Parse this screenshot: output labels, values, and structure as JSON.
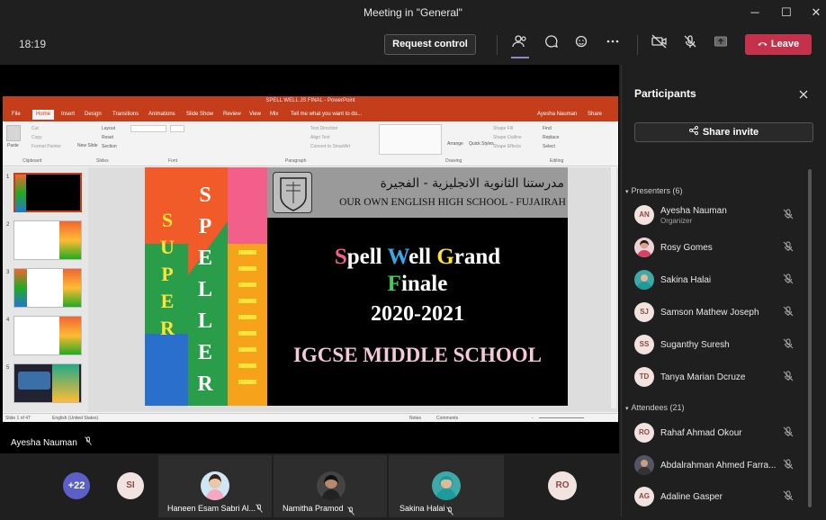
{
  "window": {
    "title": "Meeting in \"General\"",
    "minimize": "─",
    "maximize": "☐",
    "close": "✕"
  },
  "toolbar": {
    "clock": "18:19",
    "request_control": "Request control",
    "leave": "Leave"
  },
  "ppt": {
    "title": "SPELL WELL JS FINAL - PowerPoint",
    "user": "Ayesha Nauman",
    "share": "Share",
    "tell_me": "Tell me what you want to do...",
    "tabs": [
      "File",
      "Home",
      "Insert",
      "Design",
      "Transitions",
      "Animations",
      "Slide Show",
      "Review",
      "View",
      "Mix"
    ],
    "groups": [
      "Clipboard",
      "Slides",
      "Font",
      "Paragraph",
      "Drawing",
      "Editing"
    ],
    "ribbon": {
      "paste": "Paste",
      "cut": "Cut",
      "copy": "Copy",
      "format_painter": "Format Painter",
      "new_slide": "New Slide",
      "layout": "Layout",
      "reset": "Reset",
      "section": "Section",
      "text_direction": "Text Direction",
      "align_text": "Align Text",
      "smartart": "Convert to SmartArt",
      "arrange": "Arrange",
      "quick_styles": "Quick Styles",
      "shape_fill": "Shape Fill",
      "shape_outline": "Shape Outline",
      "shape_effects": "Shape Effects",
      "find": "Find",
      "replace": "Replace",
      "select": "Select"
    },
    "thumb_numbers": [
      "1",
      "2",
      "3",
      "4",
      "5"
    ],
    "status_left": "Slide 1 of 47",
    "status_lang": "English (United States)",
    "status_notes": "Notes",
    "status_comments": "Comments",
    "status_zoom": "-"
  },
  "slide": {
    "school_arabic": "مدرستنا الثانوية الانجليزية - الفجيرة",
    "school_english": "OUR OWN ENGLISH HIGH SCHOOL - FUJAIRAH",
    "super_letters": [
      "S",
      "U",
      "P",
      "E",
      "R"
    ],
    "speller_letters": [
      "S",
      "P",
      "E",
      "L",
      "L",
      "E",
      "R"
    ],
    "line1": [
      "S",
      "pell ",
      "W",
      "ell ",
      "G",
      "rand"
    ],
    "line2": [
      "F",
      "inale"
    ],
    "line3": "2020-2021",
    "line4": "IGCSE MIDDLE SCHOOL"
  },
  "stage_name": "Ayesha Nauman",
  "tiles": {
    "more_count": "+22",
    "si": "SI",
    "ro": "RO",
    "names": [
      "Haneen Esam Sabri Al...",
      "Namitha Pramod",
      "Sakina Halai"
    ]
  },
  "panel": {
    "title": "Participants",
    "share_invite": "Share invite",
    "presenters_header": "Presenters (6)",
    "attendees_header": "Attendees (21)",
    "presenters": [
      {
        "initials": "AN",
        "name": "Ayesha Nauman",
        "role": "Organizer"
      },
      {
        "initials": "",
        "name": "Rosy Gomes",
        "role": ""
      },
      {
        "initials": "",
        "name": "Sakina Halai",
        "role": ""
      },
      {
        "initials": "SJ",
        "name": "Samson Mathew Joseph",
        "role": ""
      },
      {
        "initials": "SS",
        "name": "Suganthy Suresh",
        "role": ""
      },
      {
        "initials": "TD",
        "name": "Tanya Marian Dcruze",
        "role": ""
      }
    ],
    "attendees": [
      {
        "initials": "RO",
        "name": "Rahaf Ahmad Okour"
      },
      {
        "initials": "",
        "name": "Abdalrahman Ahmed Farra..."
      },
      {
        "initials": "AG",
        "name": "Adaline Gasper"
      }
    ]
  },
  "colors": {
    "leave": "#c4314b",
    "ppt_brand": "#c43e1c",
    "accent_purple": "#6264a7"
  }
}
